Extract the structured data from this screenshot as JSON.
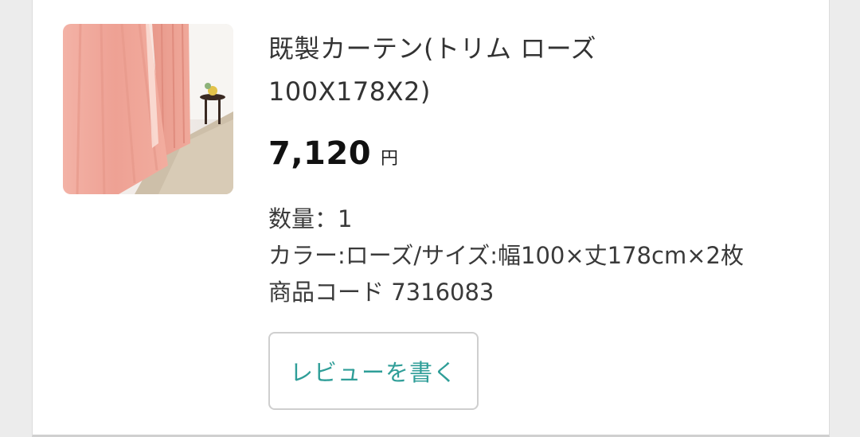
{
  "product": {
    "image_alt": "pink curtain product photo",
    "title_line1": "既製カーテン(トリム ローズ",
    "title_line2": "100X178X2)",
    "price": "7,120",
    "currency": "円",
    "quantity": "数量：1",
    "variant": "カラー:ローズ/サイズ:幅100×丈178cm×2枚",
    "product_code": "商品コード 7316083"
  },
  "actions": {
    "review_label": "レビューを書く"
  },
  "colors": {
    "review_accent": "#2f9e98",
    "curtain_pink": "#f0a79a"
  }
}
